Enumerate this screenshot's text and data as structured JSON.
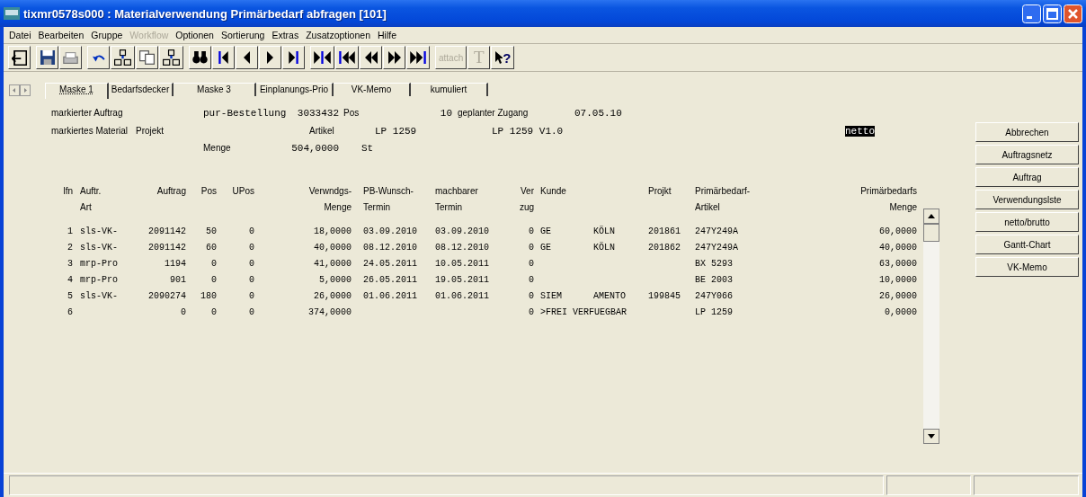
{
  "window": {
    "title": "tixmr0578s000 : Materialverwendung Primärbedarf abfragen [101]"
  },
  "menu": [
    {
      "label": "Datei",
      "disabled": false
    },
    {
      "label": "Bearbeiten",
      "disabled": false
    },
    {
      "label": "Gruppe",
      "disabled": false
    },
    {
      "label": "Workflow",
      "disabled": true
    },
    {
      "label": "Optionen",
      "disabled": false
    },
    {
      "label": "Sortierung",
      "disabled": false
    },
    {
      "label": "Extras",
      "disabled": false
    },
    {
      "label": "Zusatzoptionen",
      "disabled": false
    },
    {
      "label": "Hilfe",
      "disabled": false
    }
  ],
  "toolbar_texts": [
    {
      "kind": "text",
      "label": "attach",
      "disabled": true
    },
    {
      "kind": "glyph",
      "label": "T",
      "disabled": true
    },
    {
      "kind": "help",
      "label": "?"
    }
  ],
  "tabs": [
    {
      "label": "Maske 1",
      "selected": true
    },
    {
      "label": "Bedarfsdecker",
      "selected": false
    },
    {
      "label": "Maske 3",
      "selected": false
    },
    {
      "label": "Einplanungs-Prio",
      "selected": false
    },
    {
      "label": "VK-Memo",
      "selected": false
    },
    {
      "label": "kumuliert",
      "selected": false
    }
  ],
  "form": {
    "lines": [
      {
        "fields": [
          {
            "kind": "label",
            "text": "markierter Auftrag"
          },
          {
            "kind": "value",
            "text": "pur-Bestellung"
          },
          {
            "kind": "value",
            "text": "3033432"
          },
          {
            "kind": "label",
            "text": "Pos"
          },
          {
            "kind": "value",
            "text": "10"
          },
          {
            "kind": "label",
            "text": "geplanter Zugang"
          },
          {
            "kind": "value",
            "text": "07.05.10"
          }
        ]
      },
      {
        "fields": [
          {
            "kind": "label",
            "text": "markiertes Material"
          },
          {
            "kind": "label",
            "text": "Projekt"
          },
          {
            "kind": "label",
            "text": "Artikel"
          },
          {
            "kind": "value",
            "text": "LP 1259"
          },
          {
            "kind": "value",
            "text": "LP 1259 V1.0"
          },
          {
            "kind": "value",
            "text": "netto",
            "highlighted": true
          }
        ]
      },
      {
        "fields": [
          {
            "kind": "label",
            "text": "Menge"
          },
          {
            "kind": "value",
            "text": "504,0000"
          },
          {
            "kind": "value",
            "text": "St"
          }
        ]
      }
    ]
  },
  "table": {
    "columns": [
      {
        "top": "lfn"
      },
      {
        "top": "Auftr.",
        "bottom": "Art"
      },
      {
        "top": "Auftrag"
      },
      {
        "top": "Pos"
      },
      {
        "top": "UPos"
      },
      {
        "top": "Verwndgs-",
        "bottom": "Menge"
      },
      {
        "top": "PB-Wunsch-",
        "bottom": "Termin"
      },
      {
        "top": "machbarer",
        "bottom": "Termin"
      },
      {
        "top": "Ver",
        "bottom": "zug"
      },
      {
        "top": "Kunde"
      },
      {},
      {
        "top": "Projkt"
      },
      {
        "top": "Primärbedarf-",
        "bottom": "Artikel"
      },
      {
        "top": "Primärbedarfs",
        "bottom": "Menge"
      }
    ],
    "rows": [
      [
        "1",
        "sls-VK-",
        "2091142",
        "50",
        "0",
        "18,0000",
        "03.09.2010",
        "03.09.2010",
        "0",
        "GE",
        "KÖLN",
        "201861",
        "247Y249A",
        "60,0000"
      ],
      [
        "2",
        "sls-VK-",
        "2091142",
        "60",
        "0",
        "40,0000",
        "08.12.2010",
        "08.12.2010",
        "0",
        "GE",
        "KÖLN",
        "201862",
        "247Y249A",
        "40,0000"
      ],
      [
        "3",
        "mrp-Pro",
        "1194",
        "0",
        "0",
        "41,0000",
        "24.05.2011",
        "10.05.2011",
        "0",
        "",
        "",
        "",
        "BX 5293",
        "63,0000"
      ],
      [
        "4",
        "mrp-Pro",
        "901",
        "0",
        "0",
        "5,0000",
        "26.05.2011",
        "19.05.2011",
        "0",
        "",
        "",
        "",
        "BE 2003",
        "10,0000"
      ],
      [
        "5",
        "sls-VK-",
        "2090274",
        "180",
        "0",
        "26,0000",
        "01.06.2011",
        "01.06.2011",
        "0",
        "SIEM",
        "AMENTO",
        "199845",
        "247Y066",
        "26,0000"
      ],
      [
        "6",
        "",
        "0",
        "0",
        "0",
        "374,0000",
        "",
        "",
        "0",
        ">FREI VERFUEGBAR",
        "",
        "",
        "LP 1259",
        "0,0000"
      ]
    ]
  },
  "buttons": [
    "Abbrechen",
    "Auftragsnetz",
    "Auftrag",
    "Verwendungslste",
    "netto/brutto",
    "Gantt-Chart",
    "VK-Memo"
  ]
}
